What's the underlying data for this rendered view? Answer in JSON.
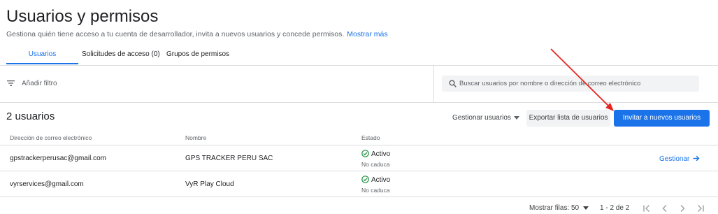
{
  "header": {
    "title": "Usuarios y permisos",
    "subtitle": "Gestiona quién tiene acceso a tu cuenta de desarrollador, invita a nuevos usuarios y concede permisos.",
    "more_link": "Mostrar más"
  },
  "tabs": [
    {
      "label": "Usuarios",
      "active": true
    },
    {
      "label": "Solicitudes de acceso (0)",
      "active": false
    },
    {
      "label": "Grupos de permisos",
      "active": false
    }
  ],
  "filter": {
    "label": "Añadir filtro"
  },
  "search": {
    "placeholder": "Buscar usuarios por nombre o dirección de correo electrónico"
  },
  "summary": {
    "count_label": "2 usuarios"
  },
  "actions": {
    "manage_users": "Gestionar usuarios",
    "export": "Exportar lista de usuarios",
    "invite": "Invitar a nuevos usuarios"
  },
  "table": {
    "columns": [
      "Dirección de correo electrónico",
      "Nombre",
      "Estado"
    ],
    "rows": [
      {
        "email": "gpstrackerperusac@gmail.com",
        "name": "GPS TRACKER PERU SAC",
        "status": "Activo",
        "expiry": "No caduca",
        "action": "Gestionar"
      },
      {
        "email": "vyrservices@gmail.com",
        "name": "VyR Play Cloud",
        "status": "Activo",
        "expiry": "No caduca",
        "action": ""
      }
    ]
  },
  "pagination": {
    "rows_label": "Mostrar filas:",
    "rows_value": "50",
    "range": "1 - 2 de 2"
  },
  "colors": {
    "accent": "#1a73e8",
    "success": "#1e8e3e",
    "annotation_arrow": "#e5251f"
  },
  "icons": [
    "filter-icon",
    "search-icon",
    "dropdown-arrow-icon",
    "check-circle-icon",
    "arrow-right-icon",
    "first-page-icon",
    "chevron-left-icon",
    "chevron-right-icon",
    "last-page-icon"
  ]
}
